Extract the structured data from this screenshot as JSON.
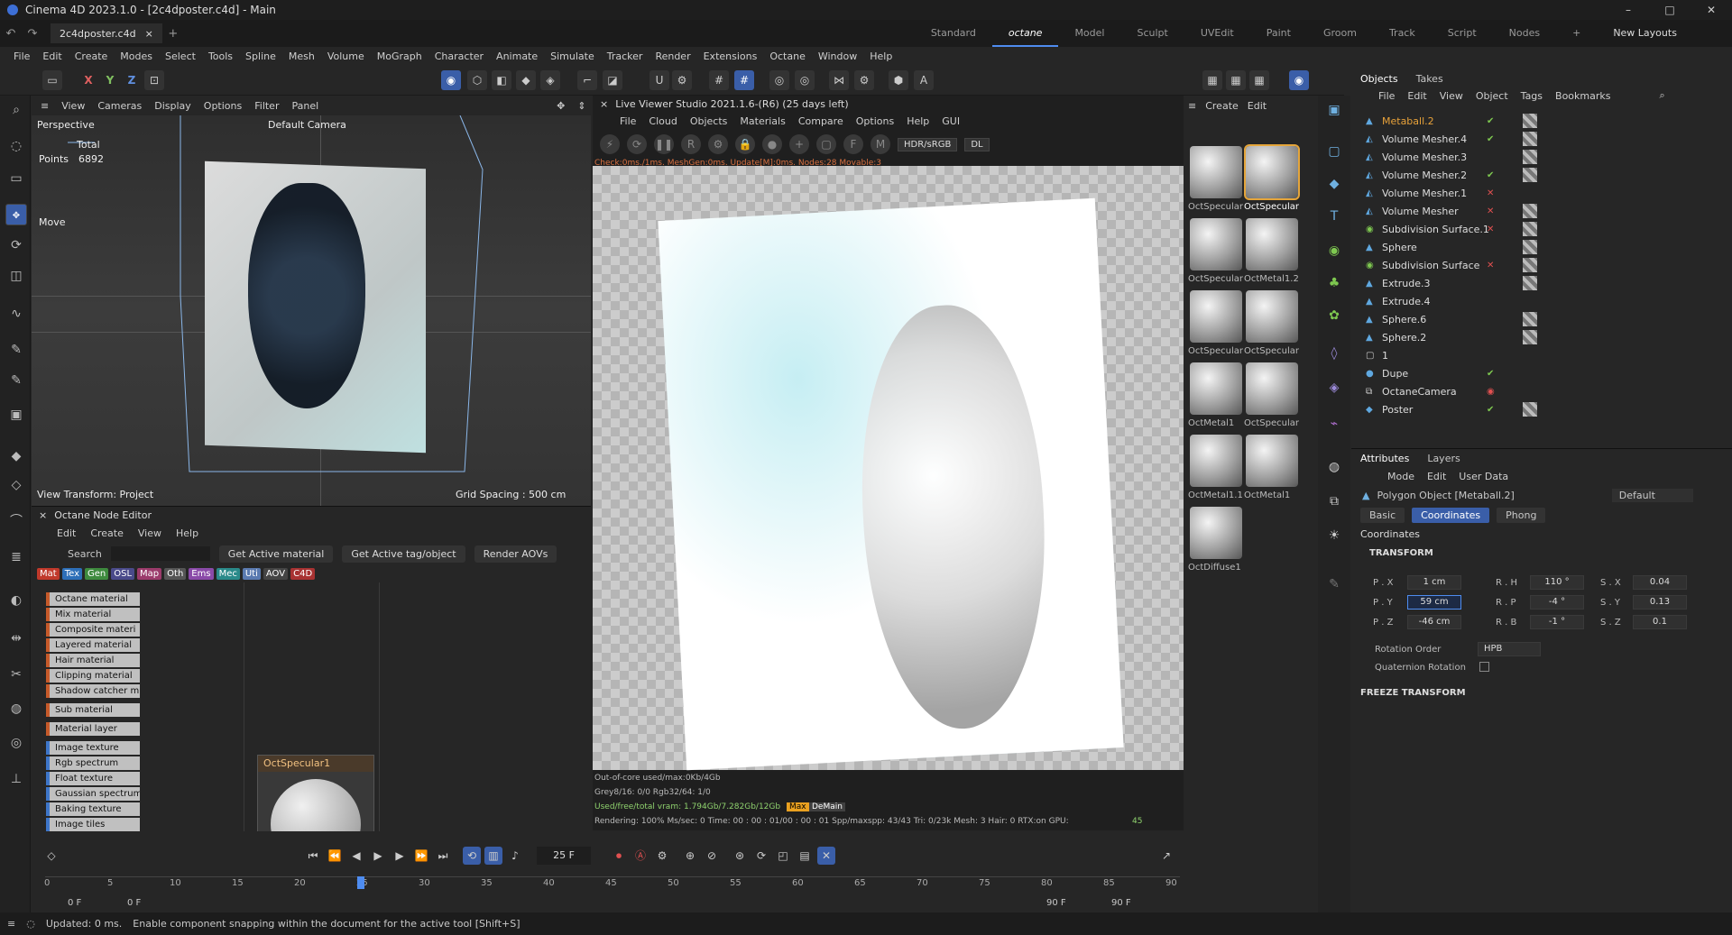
{
  "window": {
    "title": "Cinema 4D 2023.1.0 - [2c4dposter.c4d] - Main",
    "controls": [
      "–",
      "□",
      "✕"
    ]
  },
  "tabs": {
    "document": "2c4dposter.c4d",
    "layouts": [
      "Standard",
      "octane",
      "Model",
      "Sculpt",
      "UVEdit",
      "Paint",
      "Groom",
      "Track",
      "Script",
      "Nodes"
    ],
    "new_layouts": "New Layouts"
  },
  "menu": [
    "File",
    "Edit",
    "Create",
    "Modes",
    "Select",
    "Tools",
    "Spline",
    "Mesh",
    "Volume",
    "MoGraph",
    "Character",
    "Animate",
    "Simulate",
    "Tracker",
    "Render",
    "Extensions",
    "Octane",
    "Window",
    "Help"
  ],
  "toolbar": {
    "axes": [
      "X",
      "Y",
      "Z"
    ]
  },
  "viewport": {
    "menu": [
      "View",
      "Cameras",
      "Display",
      "Options",
      "Filter",
      "Panel"
    ],
    "mode": "Perspective",
    "camera": "Default Camera",
    "total_label": "Total",
    "points_label": "Points",
    "points_value": "6892",
    "tool": "Move",
    "view_transform": "View Transform: Project",
    "grid_spacing": "Grid Spacing : 500 cm"
  },
  "node_editor": {
    "title": "Octane Node Editor",
    "menu": [
      "Edit",
      "Create",
      "View",
      "Help"
    ],
    "search_label": "Search",
    "buttons": [
      "Get Active material",
      "Get Active tag/object",
      "Render AOVs"
    ],
    "categories": [
      {
        "label": "Mat",
        "color": "#c0392b"
      },
      {
        "label": "Tex",
        "color": "#2d6fb8"
      },
      {
        "label": "Gen",
        "color": "#3e8a3e"
      },
      {
        "label": "OSL",
        "color": "#4a4a8a"
      },
      {
        "label": "Map",
        "color": "#9b3b6b"
      },
      {
        "label": "Oth",
        "color": "#555555"
      },
      {
        "label": "Ems",
        "color": "#8a4aa8"
      },
      {
        "label": "Mec",
        "color": "#2a8a8a"
      },
      {
        "label": "Uti",
        "color": "#5a7ab0"
      },
      {
        "label": "AOV",
        "color": "#444444"
      },
      {
        "label": "C4D",
        "color": "#a83232"
      }
    ],
    "materials": [
      "Octane material",
      "Mix material",
      "Composite materi",
      "Layered material",
      "Hair material",
      "Clipping material",
      "Shadow catcher m",
      "Sub material",
      "Material layer"
    ],
    "textures": [
      "Image texture",
      "Rgb spectrum",
      "Float texture",
      "Gaussian spectrum",
      "Baking texture",
      "Image tiles"
    ],
    "node_card": "OctSpecular1"
  },
  "live_viewer": {
    "title": "Live Viewer Studio 2021.1.6-(R6) (25 days left)",
    "menu": [
      "File",
      "Cloud",
      "Objects",
      "Materials",
      "Compare",
      "Options",
      "Help",
      "GUI"
    ],
    "color_mode": "HDR/sRGB",
    "render_mode": "DL",
    "status_line": "Check:0ms./1ms. MeshGen:0ms. Update[M]:0ms. Nodes:28 Movable:3",
    "stats": [
      "Out-of-core used/max:0Kb/4Gb",
      "Grey8/16: 0/0          Rgb32/64: 1/0",
      "Used/free/total vram: 1.794Gb/7.282Gb/12Gb"
    ],
    "render_line": "Rendering: 100%  Ms/sec: 0    Time: 00 : 00 : 01/00 : 00 : 01   Spp/maxspp: 43/43   Tri: 0/23k   Mesh: 3   Hair: 0   RTX:on      GPU:",
    "gpu_value": "45",
    "badge_max": "Max",
    "badge_demain": "DeMain"
  },
  "material_shelf": {
    "items": [
      "OctSpecular",
      "OctSpecular",
      "OctSpecular",
      "OctMetal1.2",
      "OctSpecular",
      "OctSpecular",
      "OctMetal1",
      "OctSpecular",
      "OctMetal1.1",
      "OctMetal1",
      "OctDiffuse1"
    ]
  },
  "objects": {
    "tabs": [
      "Objects",
      "Takes"
    ],
    "menu": [
      "File",
      "Edit",
      "View",
      "Object",
      "Tags",
      "Bookmarks"
    ],
    "items": [
      {
        "name": "Metaball.2",
        "status": "check",
        "selected": true
      },
      {
        "name": "Volume Mesher.4",
        "status": "check"
      },
      {
        "name": "Volume Mesher.3",
        "status": "none"
      },
      {
        "name": "Volume Mesher.2",
        "status": "check"
      },
      {
        "name": "Volume Mesher.1",
        "status": "x"
      },
      {
        "name": "Volume Mesher",
        "status": "x"
      },
      {
        "name": "Subdivision Surface.1",
        "status": "x"
      },
      {
        "name": "Sphere",
        "status": "none"
      },
      {
        "name": "Subdivision Surface",
        "status": "x"
      },
      {
        "name": "Extrude.3",
        "status": "none"
      },
      {
        "name": "Extrude.4",
        "status": "none"
      },
      {
        "name": "Sphere.6",
        "status": "none"
      },
      {
        "name": "Sphere.2",
        "status": "none"
      },
      {
        "name": "1",
        "status": "none"
      },
      {
        "name": "Dupe",
        "status": "check"
      },
      {
        "name": "OctaneCamera",
        "status": "none"
      },
      {
        "name": "Poster",
        "status": "check"
      }
    ]
  },
  "attributes": {
    "tabs": [
      "Attributes",
      "Layers"
    ],
    "menu": [
      "Mode",
      "Edit",
      "User Data"
    ],
    "object": "Polygon Object [Metaball.2]",
    "preset": "Default",
    "subtabs": [
      "Basic",
      "Coordinates",
      "Phong"
    ],
    "section": "Coordinates",
    "transform_header": "TRANSFORM",
    "rows": [
      {
        "p_label": "P . X",
        "p": "1 cm",
        "r_label": "R . H",
        "r": "110 °",
        "s_label": "S . X",
        "s": "0.04"
      },
      {
        "p_label": "P . Y",
        "p": "59 cm",
        "r_label": "R . P",
        "r": "-4 °",
        "s_label": "S . Y",
        "s": "0.13"
      },
      {
        "p_label": "P . Z",
        "p": "-46 cm",
        "r_label": "R . B",
        "r": "-1 °",
        "s_label": "S . Z",
        "s": "0.1"
      }
    ],
    "rotation_order_label": "Rotation Order",
    "rotation_order": "HPB",
    "quaternion_label": "Quaternion Rotation",
    "freeze_label": "FREEZE TRANSFORM"
  },
  "timeline": {
    "frame": "25 F",
    "ticks": [
      "0",
      "5",
      "10",
      "15",
      "20",
      "25",
      "30",
      "35",
      "40",
      "45",
      "50",
      "55",
      "60",
      "65",
      "70",
      "75",
      "80",
      "85",
      "90"
    ],
    "start": "0 F",
    "start2": "0 F",
    "end": "90 F",
    "end2": "90 F"
  },
  "statusbar": {
    "updated": "Updated: 0 ms.",
    "hint": "Enable component snapping within the document for the active tool [Shift+S]"
  }
}
